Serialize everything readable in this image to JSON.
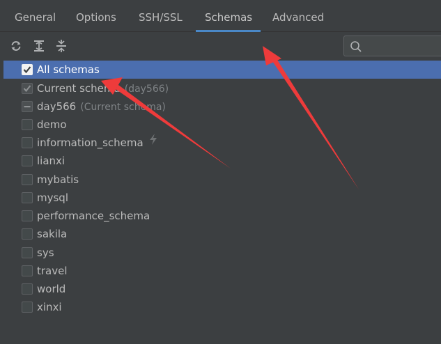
{
  "tabs": [
    {
      "label": "General",
      "active": false
    },
    {
      "label": "Options",
      "active": false
    },
    {
      "label": "SSH/SSL",
      "active": false
    },
    {
      "label": "Schemas",
      "active": true
    },
    {
      "label": "Advanced",
      "active": false
    }
  ],
  "toolbar": {
    "icons": [
      "refresh-icon",
      "expand-all-icon",
      "collapse-all-icon"
    ]
  },
  "search": {
    "placeholder": "",
    "value": ""
  },
  "schemas": {
    "items": [
      {
        "label": "All schemas",
        "hint": "",
        "state": "checked",
        "selected": true
      },
      {
        "label": "Current schema",
        "hint": "(day566)",
        "state": "checked-disabled",
        "selected": false
      },
      {
        "label": "day566",
        "hint": "(Current schema)",
        "state": "indeterminate",
        "selected": false
      },
      {
        "label": "demo",
        "hint": "",
        "state": "unchecked",
        "selected": false
      },
      {
        "label": "information_schema",
        "hint": "",
        "state": "unchecked",
        "selected": false,
        "icon": "bolt-icon"
      },
      {
        "label": "lianxi",
        "hint": "",
        "state": "unchecked",
        "selected": false
      },
      {
        "label": "mybatis",
        "hint": "",
        "state": "unchecked",
        "selected": false
      },
      {
        "label": "mysql",
        "hint": "",
        "state": "unchecked",
        "selected": false
      },
      {
        "label": "performance_schema",
        "hint": "",
        "state": "unchecked",
        "selected": false
      },
      {
        "label": "sakila",
        "hint": "",
        "state": "unchecked",
        "selected": false
      },
      {
        "label": "sys",
        "hint": "",
        "state": "unchecked",
        "selected": false
      },
      {
        "label": "travel",
        "hint": "",
        "state": "unchecked",
        "selected": false
      },
      {
        "label": "world",
        "hint": "",
        "state": "unchecked",
        "selected": false
      },
      {
        "label": "xinxi",
        "hint": "",
        "state": "unchecked",
        "selected": false
      }
    ]
  },
  "colors": {
    "background": "#3c3f41",
    "selection": "#4b6eaf",
    "tab_underline": "#4a88c7",
    "annotation_arrow": "#ee3b3b"
  }
}
